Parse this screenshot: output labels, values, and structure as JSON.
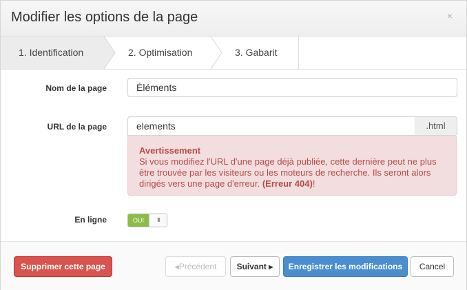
{
  "dialog": {
    "title": "Modifier les options de la page",
    "close_glyph": "×"
  },
  "steps": [
    {
      "label": "1. Identification",
      "active": true
    },
    {
      "label": "2. Optimisation",
      "active": false
    },
    {
      "label": "3. Gabarit",
      "active": false
    }
  ],
  "form": {
    "page_name": {
      "label": "Nom de la page",
      "value": "Éléments"
    },
    "page_url": {
      "label": "URL de la page",
      "value": "elements",
      "suffix": ".html"
    },
    "warning": {
      "title": "Avertissement",
      "text": "Si vous modifiez l'URL d'une page déjà publiée, cette dernière peut ne plus être trouvée par les visiteurs ou les moteurs de recherche. Ils seront alors dirigés vers une page d'erreur.",
      "code": "(Erreur 404)",
      "end": "!"
    },
    "online": {
      "label": "En ligne",
      "toggle_on": "OUI",
      "handle_glyph": "III",
      "state": "on"
    }
  },
  "footer": {
    "delete_label": "Supprimer cette page",
    "prev_label": "Précédent",
    "next_label": "Suivant",
    "save_label": "Enregistrer les modifications",
    "cancel_label": "Cancel",
    "prev_caret": "◀",
    "next_caret": "▶"
  },
  "colors": {
    "danger": "#d9534f",
    "primary": "#4a8ed0",
    "toggle_on": "#8dbb47",
    "alert_bg": "#f2dede",
    "alert_text": "#b94a48"
  }
}
